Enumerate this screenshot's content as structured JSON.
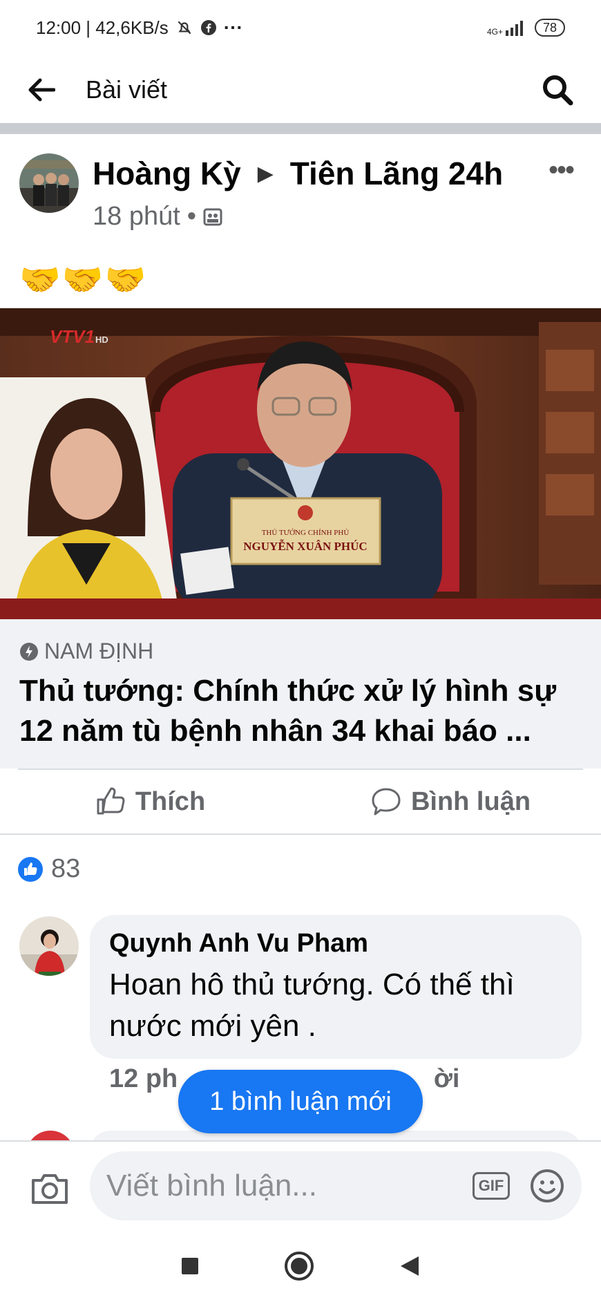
{
  "status_bar": {
    "time_net": "12:00 | 42,6KB/s",
    "network_label": "4G+",
    "battery": "78"
  },
  "app_bar": {
    "title": "Bài viết"
  },
  "post": {
    "author": "Hoàng Kỳ",
    "group": "Tiên Lãng 24h",
    "time": "18 phút",
    "emojis": "🤝🤝🤝",
    "image_texts": {
      "channel_logo": "VTV1",
      "channel_hd": "HD",
      "nameplate_title": "THỦ TƯỚNG CHÍNH PHỦ",
      "nameplate_name": "NGUYỄN XUÂN PHÚC"
    },
    "link": {
      "source": "NAM ĐỊNH",
      "title_line1": "Thủ tướng: Chính thức xử lý hình sự",
      "title_line2": "12 năm tù bệnh nhân 34 khai báo ..."
    },
    "actions": {
      "like": "Thích",
      "comment": "Bình luận"
    },
    "reaction_count": "83"
  },
  "comment": {
    "author": "Quynh Anh Vu Pham",
    "text": "Hoan hô thủ tướng. Có thế thì nước mới yên .",
    "time": "12 ph",
    "reply": "ời"
  },
  "new_comments_pill": "1 bình luận mới",
  "composer": {
    "placeholder": "Viết bình luận...",
    "gif": "GIF"
  },
  "colors": {
    "accent": "#1877f2",
    "secondary_text": "#65676b",
    "bubble": "#f0f2f5"
  },
  "icons": [
    "back-arrow-icon",
    "search-icon",
    "more-icon",
    "group-icon",
    "like-icon",
    "comment-icon",
    "camera-icon",
    "gif-icon",
    "emoji-icon",
    "nav-recent-icon",
    "nav-home-icon",
    "nav-back-icon"
  ]
}
